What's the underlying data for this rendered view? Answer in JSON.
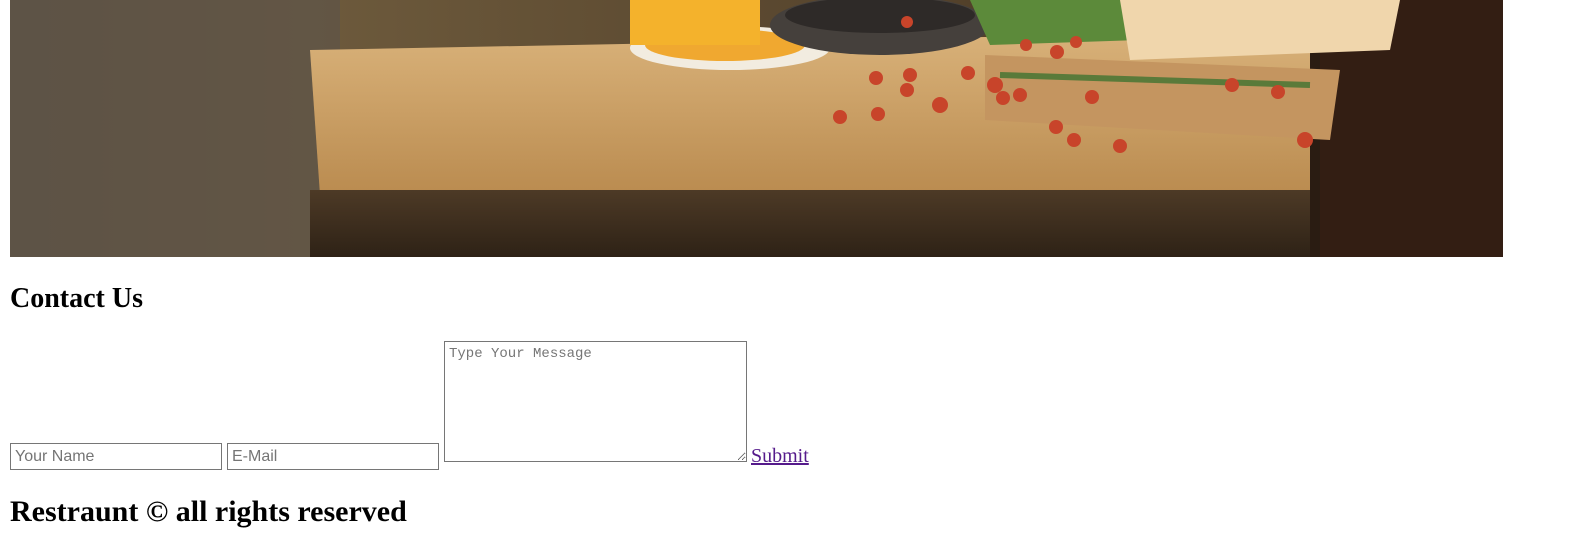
{
  "hero": {
    "alt": "restaurant table with coffee cup and tomatoes"
  },
  "contact": {
    "title": "Contact Us",
    "name_placeholder": "Your Name",
    "email_placeholder": "E-Mail",
    "message_placeholder": "Type Your Message",
    "submit_label": "Submit"
  },
  "footer": {
    "text": "Restraunt © all rights reserved"
  },
  "colors": {
    "link_visited": "#551a8b",
    "input_border": "#767676"
  }
}
